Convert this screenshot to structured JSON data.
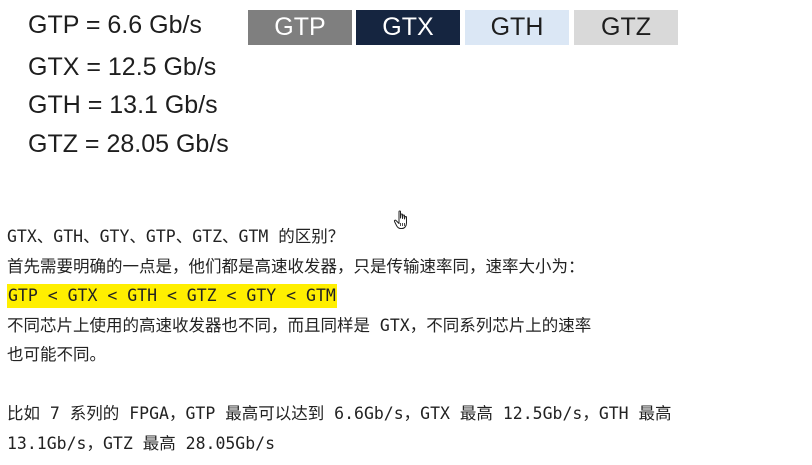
{
  "speeds": [
    "GTP = 6.6 Gb/s",
    "GTX = 12.5 Gb/s",
    "GTH = 13.1 Gb/s",
    "GTZ = 28.05 Gb/s"
  ],
  "tags": [
    "GTP",
    "GTX",
    "GTH",
    "GTZ"
  ],
  "colors": {
    "gtp_tag": "#7f7f7f",
    "gtx_tag": "#152540",
    "gth_tag": "#dbe7f5",
    "gtz_tag": "#d9d9d9",
    "highlight": "#ffef00"
  },
  "cursor_icon": "hand-pointer-icon",
  "text": {
    "question": "GTX、GTH、GTY、GTP、GTZ、GTM 的区别？",
    "intro": "首先需要明确的一点是，他们都是高速收发器，只是传输速率同，速率大小为：",
    "order": "GTP < GTX < GTH < GTZ < GTY < GTM",
    "note_line1": "不同芯片上使用的高速收发器也不同，而且同样是 GTX，不同系列芯片上的速率",
    "note_line2": "也可能不同。",
    "example_line1": "比如 7 系列的 FPGA，GTP 最高可以达到 6.6Gb/s，GTX 最高 12.5Gb/s，GTH 最高",
    "example_line2": "13.1Gb/s，GTZ 最高 28.05Gb/s"
  }
}
